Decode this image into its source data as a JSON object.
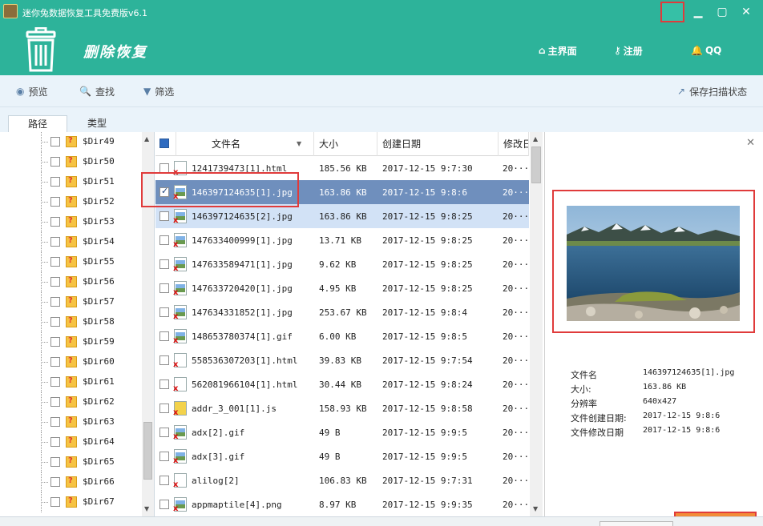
{
  "window": {
    "title": "迷你兔数据恢复工具免费版v6.1",
    "minimize_icon": "minimize-icon",
    "maximize_icon": "maximize-icon",
    "close_icon": "close-icon"
  },
  "header": {
    "title": "删除恢复",
    "nav": [
      {
        "label": "主界面",
        "icon": "home-icon"
      },
      {
        "label": "注册",
        "icon": "key-icon"
      },
      {
        "label": "QQ",
        "icon": "qq-penguin-icon"
      }
    ],
    "accent": "#2db39a"
  },
  "toolbar": {
    "preview": "预览",
    "search": "查找",
    "filter": "筛选",
    "save_scan": "保存扫描状态"
  },
  "tabs": [
    {
      "label": "路径",
      "active": true
    },
    {
      "label": "类型",
      "active": false
    }
  ],
  "tree": {
    "items": [
      "$Dir49",
      "$Dir50",
      "$Dir51",
      "$Dir52",
      "$Dir53",
      "$Dir54",
      "$Dir55",
      "$Dir56",
      "$Dir57",
      "$Dir58",
      "$Dir59",
      "$Dir60",
      "$Dir61",
      "$Dir62",
      "$Dir63",
      "$Dir64",
      "$Dir65",
      "$Dir66",
      "$Dir67"
    ]
  },
  "grid": {
    "columns": [
      "文件名",
      "大小",
      "创建日期",
      "修改日"
    ],
    "rows": [
      {
        "name": "1241739473[1].html",
        "size": "185.56 KB",
        "created": "2017-12-15 9:7:30",
        "modified": "20···",
        "type": "html",
        "checked": false,
        "state": ""
      },
      {
        "name": "146397124635[1].jpg",
        "size": "163.86 KB",
        "created": "2017-12-15 9:8:6",
        "modified": "20···",
        "type": "image",
        "checked": true,
        "state": "sel"
      },
      {
        "name": "146397124635[2].jpg",
        "size": "163.86 KB",
        "created": "2017-12-15 9:8:25",
        "modified": "20···",
        "type": "image",
        "checked": false,
        "state": "hl"
      },
      {
        "name": "147633400999[1].jpg",
        "size": "13.71 KB",
        "created": "2017-12-15 9:8:25",
        "modified": "20···",
        "type": "image",
        "checked": false,
        "state": ""
      },
      {
        "name": "147633589471[1].jpg",
        "size": "9.62 KB",
        "created": "2017-12-15 9:8:25",
        "modified": "20···",
        "type": "image",
        "checked": false,
        "state": ""
      },
      {
        "name": "147633720420[1].jpg",
        "size": "4.95 KB",
        "created": "2017-12-15 9:8:25",
        "modified": "20···",
        "type": "image",
        "checked": false,
        "state": ""
      },
      {
        "name": "147634331852[1].jpg",
        "size": "253.67 KB",
        "created": "2017-12-15 9:8:4",
        "modified": "20···",
        "type": "image",
        "checked": false,
        "state": ""
      },
      {
        "name": "148653780374[1].gif",
        "size": "6.00 KB",
        "created": "2017-12-15 9:8:5",
        "modified": "20···",
        "type": "gif",
        "checked": false,
        "state": ""
      },
      {
        "name": "558536307203[1].html",
        "size": "39.83 KB",
        "created": "2017-12-15 9:7:54",
        "modified": "20···",
        "type": "html",
        "checked": false,
        "state": ""
      },
      {
        "name": "562081966104[1].html",
        "size": "30.44 KB",
        "created": "2017-12-15 9:8:24",
        "modified": "20···",
        "type": "html",
        "checked": false,
        "state": ""
      },
      {
        "name": "addr_3_001[1].js",
        "size": "158.93 KB",
        "created": "2017-12-15 9:8:58",
        "modified": "20···",
        "type": "js",
        "checked": false,
        "state": ""
      },
      {
        "name": "adx[2].gif",
        "size": "49 B",
        "created": "2017-12-15 9:9:5",
        "modified": "20···",
        "type": "gif",
        "checked": false,
        "state": ""
      },
      {
        "name": "adx[3].gif",
        "size": "49 B",
        "created": "2017-12-15 9:9:5",
        "modified": "20···",
        "type": "gif",
        "checked": false,
        "state": ""
      },
      {
        "name": "alilog[2]",
        "size": "106.83 KB",
        "created": "2017-12-15 9:7:31",
        "modified": "20···",
        "type": "file",
        "checked": false,
        "state": ""
      },
      {
        "name": "appmaptile[4].png",
        "size": "8.97 KB",
        "created": "2017-12-15 9:9:35",
        "modified": "20···",
        "type": "png",
        "checked": false,
        "state": ""
      }
    ]
  },
  "preview": {
    "info": [
      {
        "label": "文件名",
        "value": "146397124635[1].jpg"
      },
      {
        "label": "大小:",
        "value": "163.86 KB"
      },
      {
        "label": "分辨率",
        "value": "640x427"
      },
      {
        "label": "文件创建日期:",
        "value": "2017-12-15 9:8:6"
      },
      {
        "label": "文件修改日期",
        "value": "2017-12-15 9:8:6"
      }
    ]
  },
  "colors": {
    "accent": "#2db39a",
    "selected_row": "#6f8fbd",
    "highlight_row": "#d2e2f6",
    "callout": "#e03b3b"
  }
}
